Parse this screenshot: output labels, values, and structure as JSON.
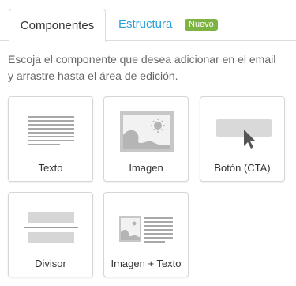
{
  "tabs": {
    "components": "Componentes",
    "structure": "Estructura",
    "badge": "Nuevo"
  },
  "instructions": "Escoja el componente que desea adicionar en el email y arrastre hasta el área de edición.",
  "components": [
    {
      "label": "Texto",
      "icon": "text-lines-icon"
    },
    {
      "label": "Imagen",
      "icon": "image-icon"
    },
    {
      "label": "Botón (CTA)",
      "icon": "button-cursor-icon"
    },
    {
      "label": "Divisor",
      "icon": "divider-icon"
    },
    {
      "label": "Imagen + Texto",
      "icon": "image-text-icon"
    }
  ],
  "colors": {
    "link": "#2a9fd8",
    "badge": "#7cb342",
    "icon_gray": "#bdbdbd"
  }
}
